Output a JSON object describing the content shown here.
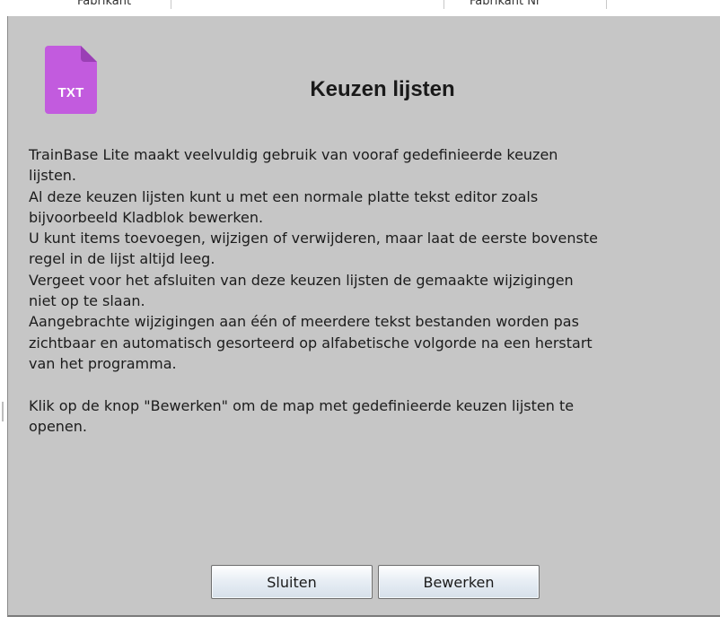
{
  "background": {
    "header_left_text": "Fabrikant",
    "header_right_text": "Fabrikant Nr"
  },
  "dialog": {
    "icon": {
      "name": "txt-file-icon",
      "label": "TXT",
      "color": "#c25bde",
      "fold_color": "#9a3fb5"
    },
    "title": "Keuzen lijsten",
    "message_lines": [
      "TrainBase Lite maakt veelvuldig gebruik van vooraf gedefinieerde keuzen",
      "lijsten.",
      "Al deze keuzen lijsten kunt u met een normale platte tekst editor zoals",
      "bijvoorbeeld Kladblok bewerken.",
      "U kunt items toevoegen, wijzigen of verwijderen, maar laat de eerste bovenste",
      "regel in de lijst altijd leeg.",
      "Vergeet voor het afsluiten van deze keuzen lijsten de gemaakte wijzigingen",
      "niet op te slaan.",
      "Aangebrachte wijzigingen aan één of meerdere tekst bestanden worden pas",
      "zichtbaar en automatisch gesorteerd op alfabetische volgorde na een herstart",
      "van het programma.",
      "",
      "Klik op de knop \"Bewerken\" om de map met gedefinieerde keuzen lijsten te",
      "openen."
    ],
    "buttons": {
      "close_label": "Sluiten",
      "edit_label": "Bewerken"
    }
  }
}
